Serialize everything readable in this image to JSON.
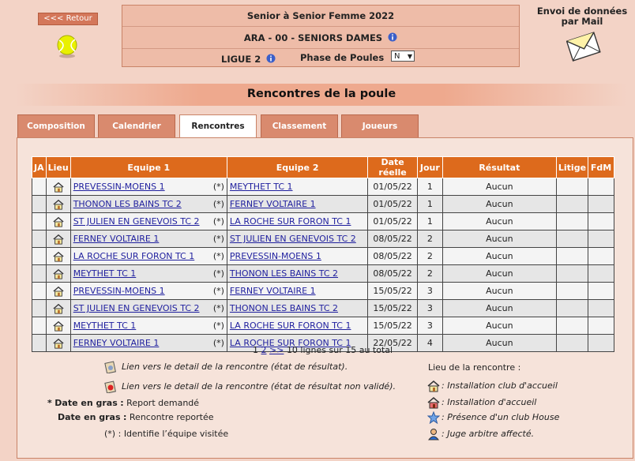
{
  "nav": {
    "retour_label": "<<< Retour"
  },
  "header": {
    "line1": "Senior  à Senior  Femme  2022",
    "line2": "ARA - 00 - SENIORS DAMES",
    "ligue": "LIGUE 2",
    "phase_label": "Phase de Poules",
    "phase_value": "N"
  },
  "mail": {
    "title": "Envoi de données par Mail"
  },
  "section_title": "Rencontres de la poule",
  "tabs": [
    {
      "label": "Composition"
    },
    {
      "label": "Calendrier"
    },
    {
      "label": "Rencontres"
    },
    {
      "label": "Classement"
    },
    {
      "label": "Joueurs"
    }
  ],
  "table": {
    "headers": [
      "JA",
      "Lieu",
      "Equipe 1",
      "Equipe 2",
      "Date réelle",
      "Jour",
      "Résultat",
      "Litige",
      "FdM"
    ],
    "rows": [
      {
        "team1": "PREVESSIN-MOENS 1",
        "visit": "(*)",
        "team2": "MEYTHET TC 1",
        "date": "01/05/22",
        "day": "1",
        "result": "Aucun"
      },
      {
        "team1": "THONON LES BAINS TC 2",
        "visit": "(*)",
        "team2": "FERNEY VOLTAIRE 1",
        "date": "01/05/22",
        "day": "1",
        "result": "Aucun"
      },
      {
        "team1": "ST JULIEN EN GENEVOIS TC 2",
        "visit": "(*)",
        "team2": "LA ROCHE SUR FORON TC 1",
        "date": "01/05/22",
        "day": "1",
        "result": "Aucun"
      },
      {
        "team1": "FERNEY VOLTAIRE 1",
        "visit": "(*)",
        "team2": "ST JULIEN EN GENEVOIS TC 2",
        "date": "08/05/22",
        "day": "2",
        "result": "Aucun"
      },
      {
        "team1": "LA ROCHE SUR FORON TC 1",
        "visit": "(*)",
        "team2": "PREVESSIN-MOENS 1",
        "date": "08/05/22",
        "day": "2",
        "result": "Aucun"
      },
      {
        "team1": "MEYTHET TC 1",
        "visit": "(*)",
        "team2": "THONON LES BAINS TC 2",
        "date": "08/05/22",
        "day": "2",
        "result": "Aucun"
      },
      {
        "team1": "PREVESSIN-MOENS 1",
        "visit": "(*)",
        "team2": "FERNEY VOLTAIRE 1",
        "date": "15/05/22",
        "day": "3",
        "result": "Aucun"
      },
      {
        "team1": "ST JULIEN EN GENEVOIS TC 2",
        "visit": "(*)",
        "team2": "THONON LES BAINS TC 2",
        "date": "15/05/22",
        "day": "3",
        "result": "Aucun"
      },
      {
        "team1": "MEYTHET TC 1",
        "visit": "(*)",
        "team2": "LA ROCHE SUR FORON TC 1",
        "date": "15/05/22",
        "day": "3",
        "result": "Aucun"
      },
      {
        "team1": "FERNEY VOLTAIRE 1",
        "visit": "(*)",
        "team2": "LA ROCHE SUR FORON TC 1",
        "date": "22/05/22",
        "day": "4",
        "result": "Aucun"
      }
    ]
  },
  "pager": {
    "page1": "1",
    "page2": "2",
    "next": ">>",
    "summary": "10 lignes sur 15 au total"
  },
  "legend": {
    "link_result": "Lien vers le detail de la rencontre (état de résultat).",
    "link_unvalidated": "Lien vers le detail de la rencontre (état de résultat non validé).",
    "star": "*",
    "date_bold_label": "Date en gras",
    "colon": ":",
    "report_requested": "Report demandé",
    "match_rescheduled": "Rencontre reportée",
    "visit_marker": "(*)",
    "visit_desc": "Identifie l’équipe visitée",
    "place_title": "Lieu de la rencontre :",
    "place_home": ": Installation club d'accueil",
    "place_home2": ": Installation d'accueil",
    "place_house": ": Présence d'un club House",
    "place_referee": ": Juge arbitre affecté."
  },
  "colors": {
    "accent": "#dd6a1c",
    "tab": "#d98a6e",
    "background": "#f3d3c6",
    "link": "#1f1f9e"
  }
}
